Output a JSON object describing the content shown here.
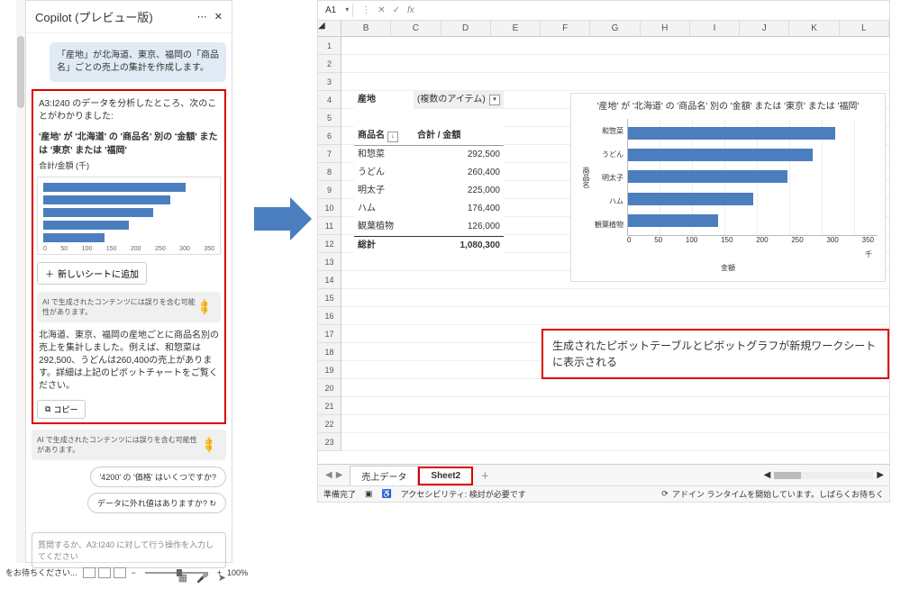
{
  "copilot": {
    "title": "Copilot (プレビュー版)",
    "user_msg": "「産地」が北海道、東京、福岡の「商品名」ごとの売上の集計を作成します。",
    "analysis_intro": "A3:I240 のデータを分析したところ、次のことがわかりました:",
    "analysis_title": "'産地' が '北海道' の '商品名' 別の '金額' または '東京' または '福岡'",
    "analysis_sub": "合計/金額 (千)",
    "add_sheet_btn": "新しいシートに追加",
    "ai_note": "AI で生成されたコンテンツには誤りを含む可能性があります。",
    "summary": "北海道、東京、福岡の産地ごとに商品名別の売上を集計しました。例えば、和惣菜は292,500、うどんは260,400の売上があります。詳細は上記のピボットチャートをご覧ください。",
    "copy_btn": "コピー",
    "ai_note2": "AI で生成されたコンテンツには誤りを含む可能性があります。",
    "suggest1": "'4200' の '価格' はいくつですか?",
    "suggest2": "データに外れ値はありますか?",
    "input_placeholder": "質問するか、A3:I240 に対して行う操作を入力してください"
  },
  "mini_axis": [
    "0",
    "50",
    "100",
    "150",
    "200",
    "250",
    "300",
    "350"
  ],
  "status_left": {
    "wait": "をお待ちください...",
    "zoom": "100%"
  },
  "excel": {
    "cell_ref": "A1",
    "fx": "fx",
    "cols": [
      "B",
      "C",
      "D",
      "E",
      "F",
      "G",
      "H",
      "I",
      "J",
      "K",
      "L"
    ],
    "rows": [
      "1",
      "2",
      "3",
      "4",
      "5",
      "6",
      "7",
      "8",
      "9",
      "10",
      "11",
      "12",
      "13",
      "14",
      "15",
      "16",
      "17",
      "18",
      "19",
      "20",
      "21",
      "22",
      "23"
    ],
    "pivot": {
      "filter_label": "産地",
      "filter_value": "(複数のアイテム)",
      "col1_header": "商品名",
      "col2_header": "合計 / 金額",
      "rows": [
        {
          "name": "和惣菜",
          "value": "292,500"
        },
        {
          "name": "うどん",
          "value": "260,400"
        },
        {
          "name": "明太子",
          "value": "225,000"
        },
        {
          "name": "ハム",
          "value": "176,400"
        },
        {
          "name": "観葉植物",
          "value": "126,000"
        }
      ],
      "total_label": "総計",
      "total_value": "1,080,300"
    },
    "callout": "生成されたピボットテーブルとピボットグラフが新規ワークシートに表示される",
    "tabs": {
      "tab1": "売上データ",
      "tab2": "Sheet2"
    },
    "status": {
      "ready": "準備完了",
      "access": "アクセシビリティ: 検討が必要です",
      "addin": "アドイン ランタイムを開始しています。しばらくお待ちく"
    }
  },
  "chart_data": {
    "type": "bar",
    "title": "'産地' が '北海道' の '商品名' 別の '金額' または '東京' または '福岡'",
    "categories": [
      "和惣菜",
      "うどん",
      "明太子",
      "ハム",
      "観葉植物"
    ],
    "values": [
      292.5,
      260.4,
      225.0,
      176.4,
      126.0
    ],
    "xlabel": "千",
    "ylabel": "商品名",
    "legend": "金額",
    "xlim": [
      0,
      350
    ],
    "xticks": [
      "0",
      "50",
      "100",
      "150",
      "200",
      "250",
      "300",
      "350"
    ]
  }
}
